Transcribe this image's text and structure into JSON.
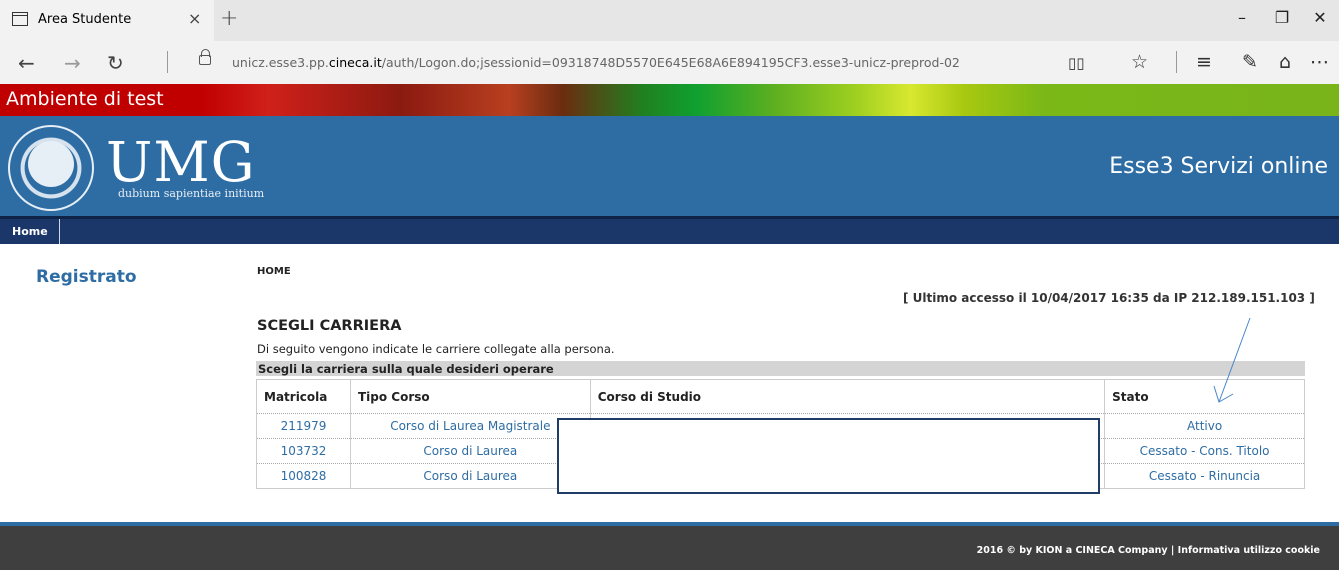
{
  "browser": {
    "tab_title": "Area Studente",
    "tab_close": "×",
    "new_tab": "+",
    "url_prefix": "unicz.esse3.pp.",
    "url_domain": "cineca.it",
    "url_path": "/auth/Logon.do;jsessionid=09318748D5570E645E68A6E894195CF3.esse3-unicz-preprod-02",
    "window_controls": [
      "–",
      "❐",
      "✕"
    ],
    "nav_icons": [
      "back-icon",
      "forward-icon",
      "refresh-icon",
      "lock-icon"
    ],
    "toolbar_icons": [
      "reading-view-icon",
      "favorite-star-icon",
      "hub-icon",
      "web-note-icon",
      "share-icon",
      "more-icon"
    ]
  },
  "banner": {
    "text": "Ambiente di test"
  },
  "header": {
    "logo_text": "UMG",
    "motto": "dubium sapientiae initium",
    "service_title": "Esse3 Servizi online"
  },
  "menu": {
    "home": "Home"
  },
  "sidebar": {
    "title": "Registrato"
  },
  "content": {
    "breadcrumb": "HOME",
    "last_access": "[ Ultimo accesso il 10/04/2017 16:35 da IP 212.189.151.103 ]",
    "page_title": "SCEGLI CARRIERA",
    "description": "Di seguito vengono indicate le carriere collegate alla persona.",
    "table_caption": "Scegli la carriera sulla quale desideri operare",
    "columns": [
      "Matricola",
      "Tipo Corso",
      "Corso di Studio",
      "Stato"
    ],
    "rows": [
      {
        "matricola": "211979",
        "tipo_corso": "Corso di Laurea Magistrale",
        "corso_studio": "",
        "stato": "Attivo"
      },
      {
        "matricola": "103732",
        "tipo_corso": "Corso di Laurea",
        "corso_studio": "",
        "stato": "Cessato - Cons. Titolo"
      },
      {
        "matricola": "100828",
        "tipo_corso": "Corso di Laurea",
        "corso_studio": "",
        "stato": "Cessato - Rinuncia"
      }
    ]
  },
  "footer": {
    "text": "2016 © by KION a CINECA Company | Informativa utilizzo cookie"
  },
  "colors": {
    "brand_blue": "#2e6da4",
    "menu_navy": "#1b3668",
    "footer_gray": "#3f3f3f",
    "test_red": "#c00000",
    "test_green": "#78b41a"
  }
}
